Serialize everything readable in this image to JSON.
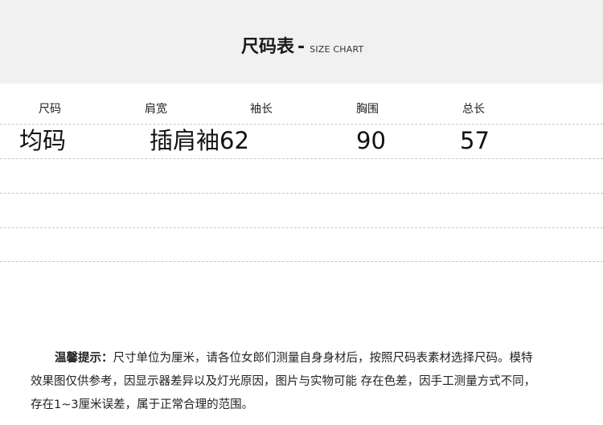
{
  "title": {
    "main": "尺码表",
    "separator": "-",
    "sub": "SIZE CHART"
  },
  "table": {
    "headers": [
      "尺码",
      "肩宽",
      "袖长",
      "胸围",
      "总长"
    ],
    "rows": [
      [
        "均码",
        "插肩袖62",
        "",
        "90",
        "57"
      ]
    ]
  },
  "note": {
    "label": "温馨提示：",
    "line1": "尺寸单位为厘米，请各位女郎们测量自身身材后，按照尺码表素材选择尺码。模特",
    "line2": "效果图仅供参考，因显示器差异以及灯光原因，图片与实物可能 存在色差，因手工测量方式不同，",
    "line3": "存在1~3厘米误差，属于正常合理的范围。"
  }
}
